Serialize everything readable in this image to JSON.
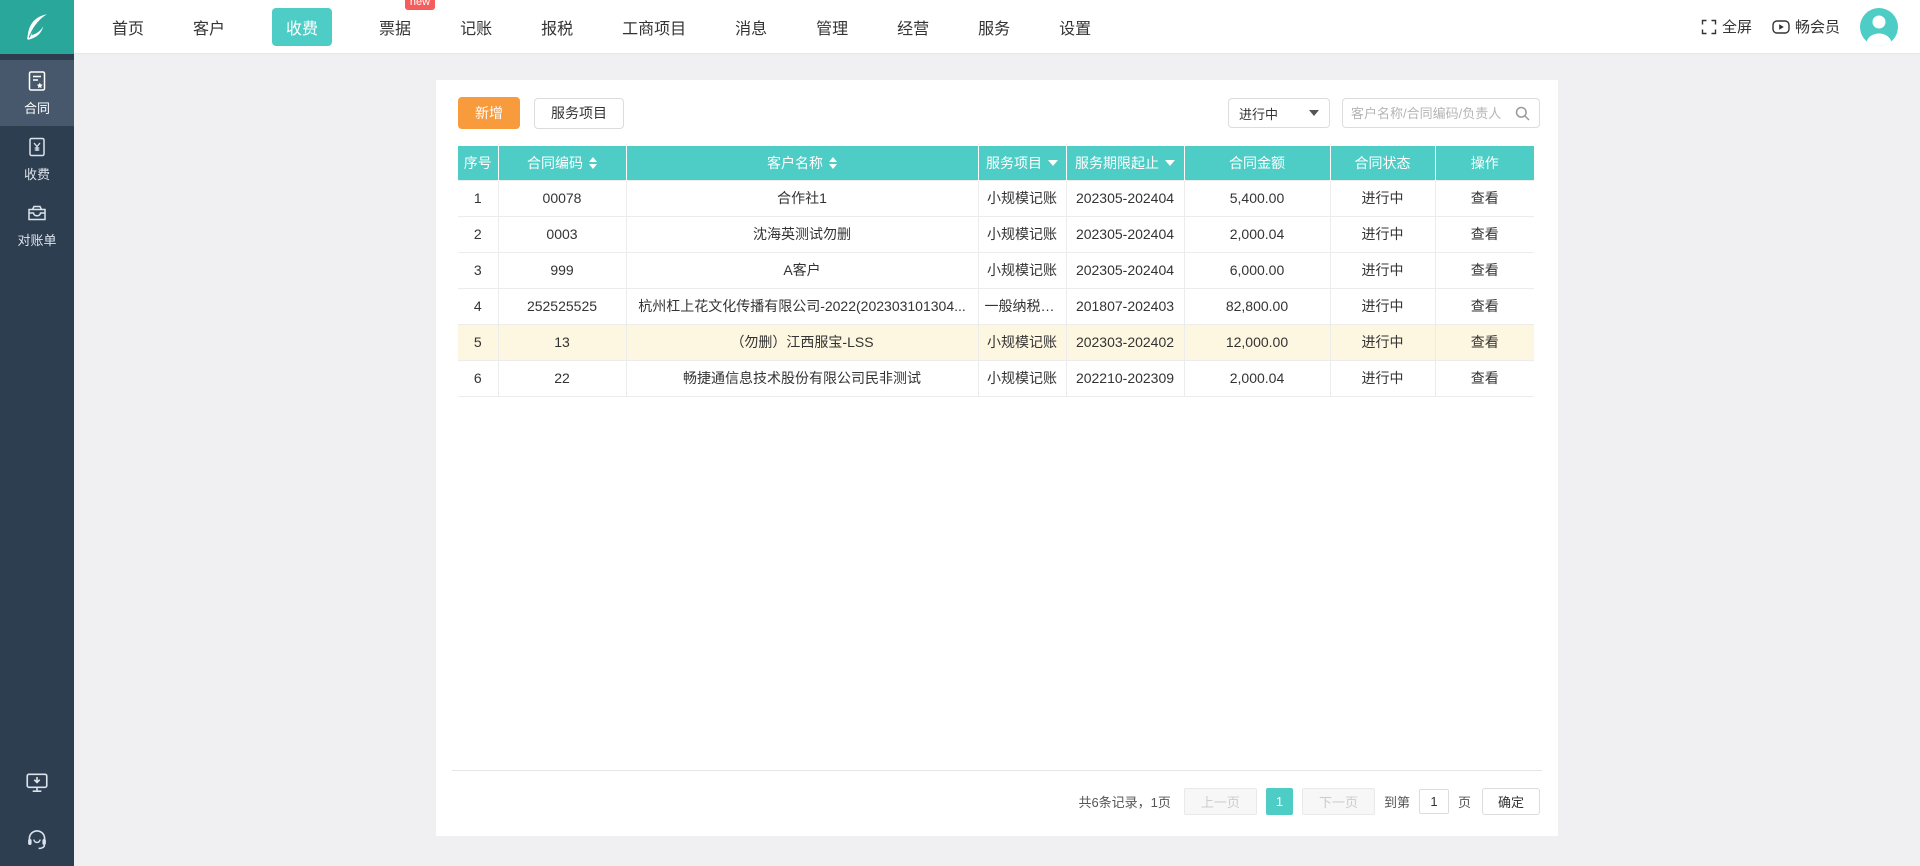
{
  "nav": {
    "items": [
      {
        "label": "首页",
        "active": false
      },
      {
        "label": "客户",
        "active": false
      },
      {
        "label": "收费",
        "active": true
      },
      {
        "label": "票据",
        "active": false,
        "badge": "new"
      },
      {
        "label": "记账",
        "active": false
      },
      {
        "label": "报税",
        "active": false
      },
      {
        "label": "工商项目",
        "active": false
      },
      {
        "label": "消息",
        "active": false
      },
      {
        "label": "管理",
        "active": false
      },
      {
        "label": "经营",
        "active": false
      },
      {
        "label": "服务",
        "active": false
      },
      {
        "label": "设置",
        "active": false
      }
    ],
    "fullscreen_label": "全屏",
    "member_label": "畅会员"
  },
  "sidebar": {
    "items": [
      {
        "label": "合同",
        "icon": "contract-icon",
        "active": true
      },
      {
        "label": "收费",
        "icon": "fee-icon",
        "active": false
      },
      {
        "label": "对账单",
        "icon": "statement-icon",
        "active": false
      }
    ]
  },
  "toolbar": {
    "add_label": "新增",
    "service_label": "服务项目",
    "status_filter_value": "进行中",
    "search_placeholder": "客户名称/合同编码/负责人"
  },
  "table": {
    "columns": [
      {
        "label": "序号"
      },
      {
        "label": "合同编码",
        "sortable": true
      },
      {
        "label": "客户名称",
        "sortable": true
      },
      {
        "label": "服务项目",
        "filterable": true
      },
      {
        "label": "服务期限起止",
        "filterable": true
      },
      {
        "label": "合同金额"
      },
      {
        "label": "合同状态"
      },
      {
        "label": "操作"
      }
    ],
    "rows": [
      {
        "index": "1",
        "code": "00078",
        "customer": "合作社1",
        "service": "小规模记账",
        "period": "202305-202404",
        "amount": "5,400.00",
        "status": "进行中",
        "action": "查看"
      },
      {
        "index": "2",
        "code": "0003",
        "customer": "沈海英测试勿删",
        "service": "小规模记账",
        "period": "202305-202404",
        "amount": "2,000.04",
        "status": "进行中",
        "action": "查看"
      },
      {
        "index": "3",
        "code": "999",
        "customer": "A客户",
        "service": "小规模记账",
        "period": "202305-202404",
        "amount": "6,000.00",
        "status": "进行中",
        "action": "查看"
      },
      {
        "index": "4",
        "code": "252525525",
        "customer": "杭州杠上花文化传播有限公司-2022(202303101304...",
        "service": "一般纳税人...",
        "period": "201807-202403",
        "amount": "82,800.00",
        "status": "进行中",
        "action": "查看"
      },
      {
        "index": "5",
        "code": "13",
        "customer": "（勿删）江西服宝-LSS",
        "service": "小规模记账",
        "period": "202303-202402",
        "amount": "12,000.00",
        "status": "进行中",
        "action": "查看",
        "highlighted": true
      },
      {
        "index": "6",
        "code": "22",
        "customer": "畅捷通信息技术股份有限公司民非测试",
        "service": "小规模记账",
        "period": "202210-202309",
        "amount": "2,000.04",
        "status": "进行中",
        "action": "查看"
      }
    ]
  },
  "pagination": {
    "summary": "共6条记录，1页",
    "prev_label": "上一页",
    "current_page": "1",
    "next_label": "下一页",
    "goto_prefix": "到第",
    "goto_value": "1",
    "goto_suffix": "页",
    "confirm_label": "确定"
  },
  "colors": {
    "accent_teal": "#4dcdc6",
    "logo_teal": "#2aa79b",
    "sidebar_bg": "#2d3e50",
    "sidebar_active_bg": "#47586c",
    "add_button_orange": "#f79b3d",
    "badge_red": "#f55c5c",
    "row_highlight_yellow": "#fdf6e0"
  }
}
